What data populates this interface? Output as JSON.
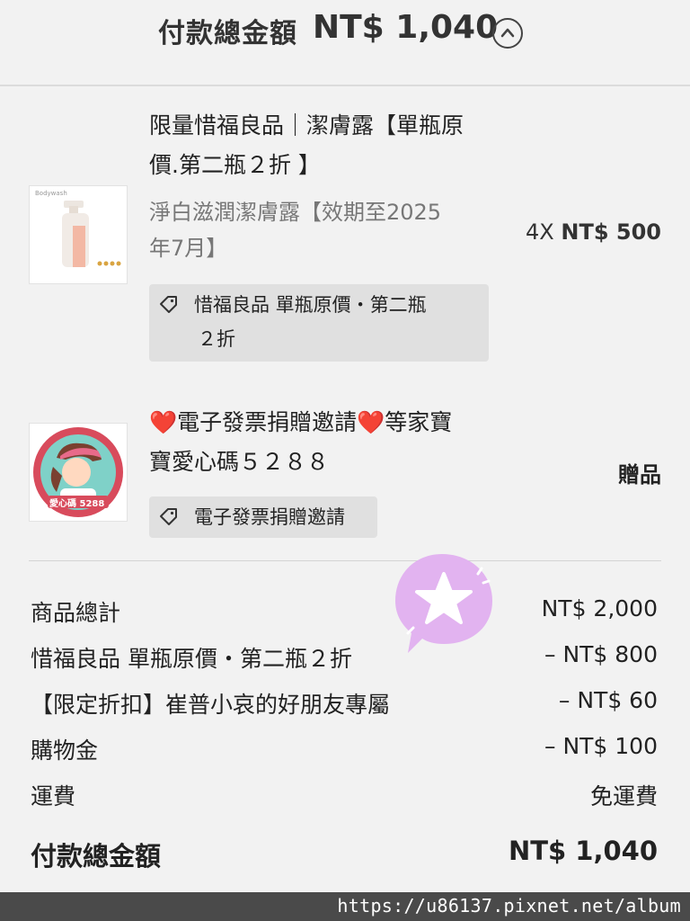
{
  "header": {
    "title": "付款總金額",
    "amount": "NT$ 1,040"
  },
  "items": [
    {
      "name_line1": "限量惜福良品｜潔膚露【單瓶原",
      "name_line2": "價.第二瓶２折 】",
      "variant_line1": "淨白滋潤潔膚露【效期至2025",
      "variant_line2": "年7月】",
      "thumb_text": "Bodywash",
      "tag_line1": "惜福良品 單瓶原價・第二瓶",
      "tag_line2": "２折",
      "qty": "4X",
      "price": "NT$ 500"
    },
    {
      "name_line1": "❤️電子發票捐贈邀請❤️等家寶",
      "name_line2": "寶愛心碼５２８８",
      "thumb_text": "愛心碼 5288",
      "tag_line1": "電子發票捐贈邀請",
      "gift_label": "贈品"
    }
  ],
  "summary": [
    {
      "label": "商品總計",
      "value": "NT$ 2,000"
    },
    {
      "label": "惜福良品 單瓶原價・第二瓶２折",
      "value": "– NT$ 800"
    },
    {
      "label": "【限定折扣】崔普小哀的好朋友專屬",
      "value": "– NT$ 60"
    },
    {
      "label": "購物金",
      "value": "– NT$ 100"
    },
    {
      "label": "運費",
      "value": "免運費"
    }
  ],
  "total": {
    "label": "付款總金額",
    "value": "NT$ 1,040"
  },
  "watermark": "https://u86137.pixnet.net/album",
  "colors": {
    "tag_bg": "#e0e0e0",
    "sticker": "#e2b3f0",
    "page_bg": "#f2f2f2"
  }
}
